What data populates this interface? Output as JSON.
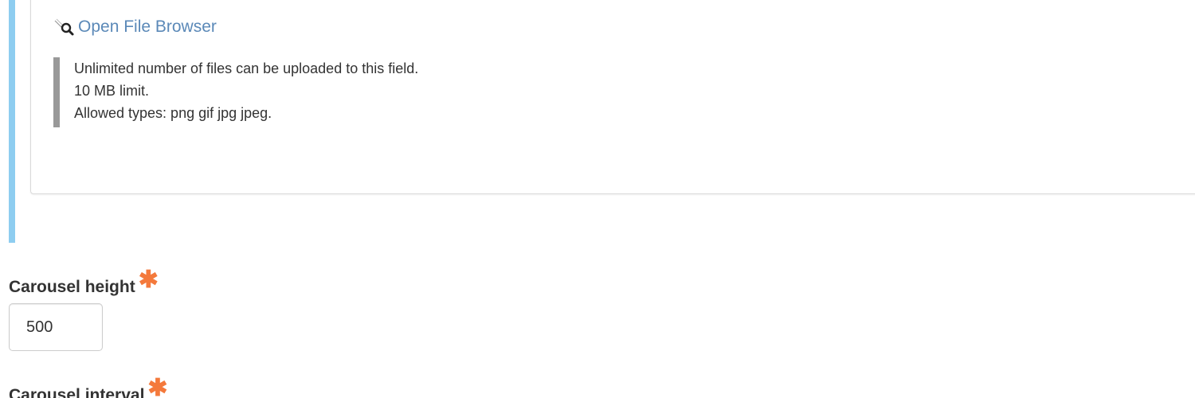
{
  "file_field": {
    "open_browser_label": "Open File Browser",
    "open_browser_icon": "magnifier-icon",
    "help_lines": [
      "Unlimited number of files can be uploaded to this field.",
      "10 MB limit.",
      "Allowed types: png gif jpg jpeg."
    ]
  },
  "carousel_height": {
    "label": "Carousel height",
    "required_marker": "✱",
    "value": "500"
  },
  "carousel_interval": {
    "label": "Carousel interval",
    "required_marker": "✱"
  },
  "colors": {
    "accent_bar": "#8ecdf0",
    "link": "#5b89b8",
    "required": "#f4793b"
  }
}
